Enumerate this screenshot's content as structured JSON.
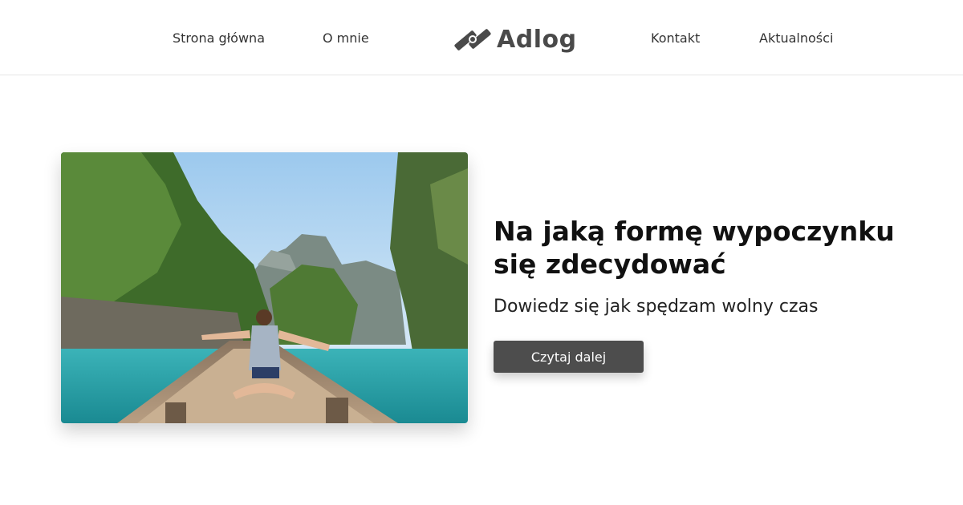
{
  "nav": {
    "left": [
      {
        "label": "Strona główna"
      },
      {
        "label": "O mnie"
      }
    ],
    "right": [
      {
        "label": "Kontakt"
      },
      {
        "label": "Aktualności"
      }
    ]
  },
  "logo": {
    "text": "Adlog",
    "icon": "link-chain-icon"
  },
  "hero": {
    "image": "woman-on-boat-tropical-lagoon",
    "title": "Na jaką formę wypoczynku się zdecydować",
    "subtitle": "Dowiedz się jak spędzam wolny czas",
    "button_label": "Czytaj dalej"
  },
  "colors": {
    "button_bg": "#4d4d4d",
    "logo": "#4a4a4a",
    "header_border": "#e6e6e6"
  }
}
